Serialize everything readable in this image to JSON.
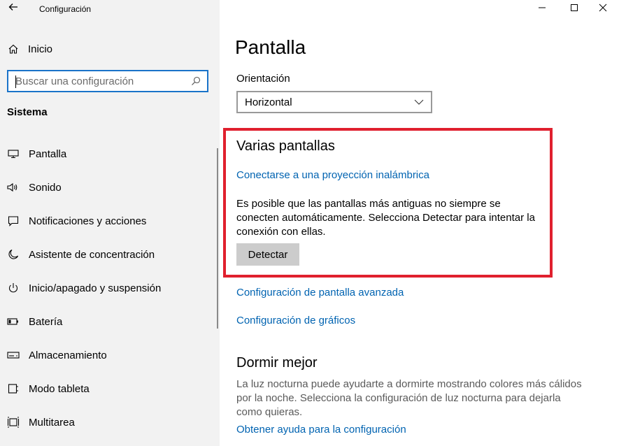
{
  "window": {
    "title": "Configuración",
    "back_icon": "back-arrow-icon",
    "minimize_icon": "minimize-icon",
    "maximize_icon": "maximize-icon",
    "close_icon": "close-icon"
  },
  "sidebar": {
    "home_label": "Inicio",
    "home_icon": "home-icon",
    "search": {
      "value": "",
      "placeholder": "Buscar una configuración",
      "icon": "search-icon"
    },
    "section_title": "Sistema",
    "items": [
      {
        "label": "Pantalla",
        "icon": "monitor-icon"
      },
      {
        "label": "Sonido",
        "icon": "speaker-icon"
      },
      {
        "label": "Notificaciones y acciones",
        "icon": "notification-icon"
      },
      {
        "label": "Asistente de concentración",
        "icon": "moon-icon"
      },
      {
        "label": "Inicio/apagado y suspensión",
        "icon": "power-icon"
      },
      {
        "label": "Batería",
        "icon": "battery-icon"
      },
      {
        "label": "Almacenamiento",
        "icon": "storage-icon"
      },
      {
        "label": "Modo tableta",
        "icon": "tablet-icon"
      },
      {
        "label": "Multitarea",
        "icon": "multitask-icon"
      }
    ]
  },
  "main": {
    "title": "Pantalla",
    "orientation": {
      "label": "Orientación",
      "value": "Horizontal"
    },
    "multiple_displays": {
      "heading": "Varias pantallas",
      "wireless_link": "Conectarse a una proyección inalámbrica",
      "description": "Es posible que las pantallas más antiguas no siempre se conecten automáticamente. Selecciona Detectar para intentar la conexión con ellas.",
      "detect_button": "Detectar"
    },
    "advanced_link": "Configuración de pantalla avanzada",
    "graphics_link": "Configuración de gráficos",
    "sleep": {
      "heading": "Dormir mejor",
      "description": "La luz nocturna puede ayudarte a dormirte mostrando colores más cálidos por la noche. Selecciona la configuración de luz nocturna para dejarla como quieras.",
      "help_link": "Obtener ayuda para la configuración"
    }
  },
  "colors": {
    "accent": "#0063b1",
    "highlight_border": "#e0202e",
    "sidebar_bg": "#f2f2f2"
  }
}
